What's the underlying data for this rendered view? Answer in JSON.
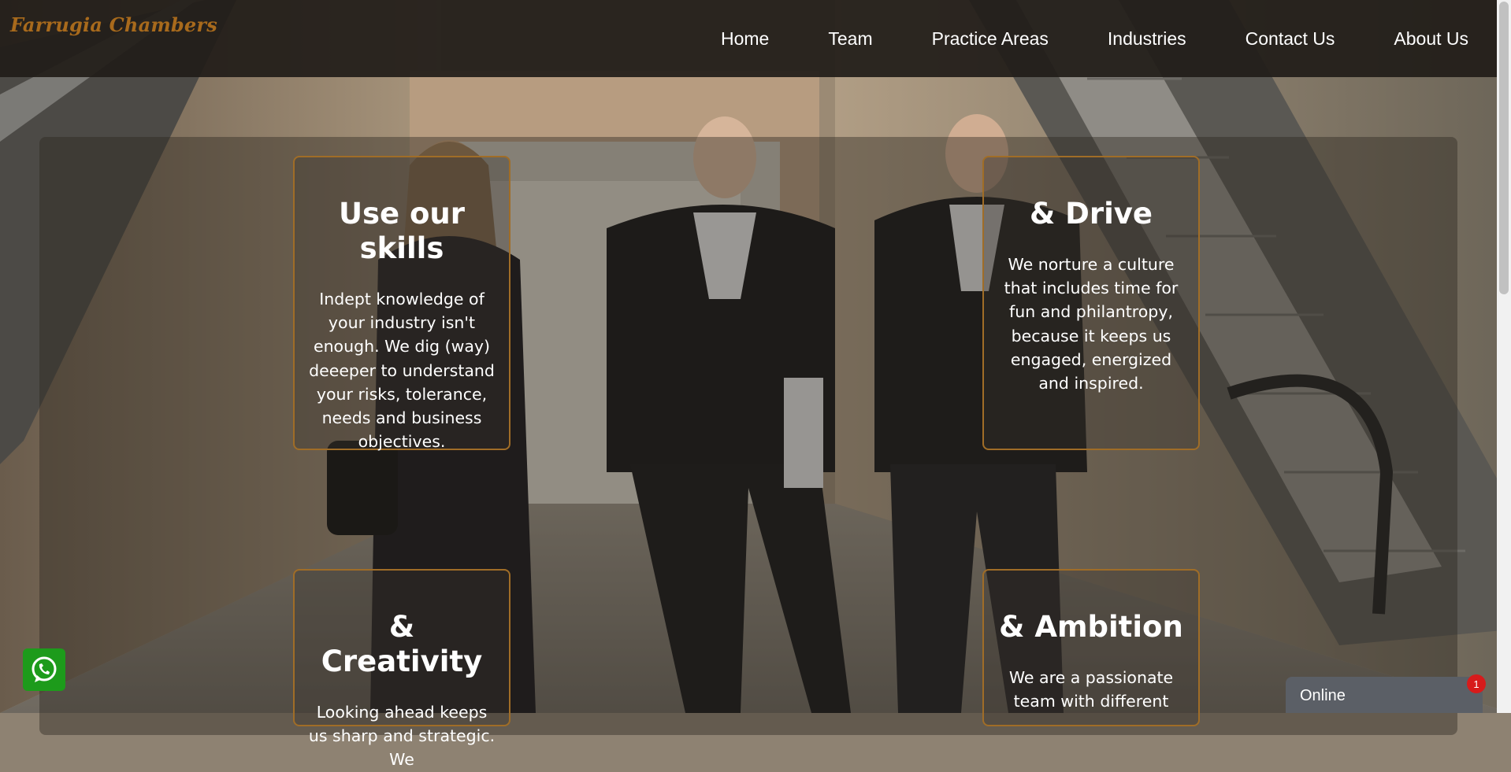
{
  "brand": "Farrugia Chambers",
  "nav": {
    "home": "Home",
    "team": "Team",
    "practice_areas": "Practice Areas",
    "industries": "Industries",
    "contact_us": "Contact Us",
    "about_us": "About Us"
  },
  "cards": [
    {
      "title": "Use our skills",
      "text": "Indept knowledge of your industry isn't enough. We dig (way) deeeper to understand your risks, tolerance, needs and business objectives."
    },
    {
      "title": "& Drive",
      "text": "We norture a culture that includes time for fun and philantropy, because it keeps us engaged, energized and inspired."
    },
    {
      "title": "& Creativity",
      "text": "Looking ahead keeps us sharp and strategic. We"
    },
    {
      "title": "& Ambition",
      "text": "We are a passionate team with different"
    }
  ],
  "chat": {
    "label": "Online",
    "badge": "1"
  },
  "icons": {
    "whatsapp": "whatsapp-icon"
  },
  "colors": {
    "brand": "#a86a1c",
    "card_border": "#a06d27",
    "whatsapp": "#1d9b1b",
    "badge": "#d71b1b"
  }
}
